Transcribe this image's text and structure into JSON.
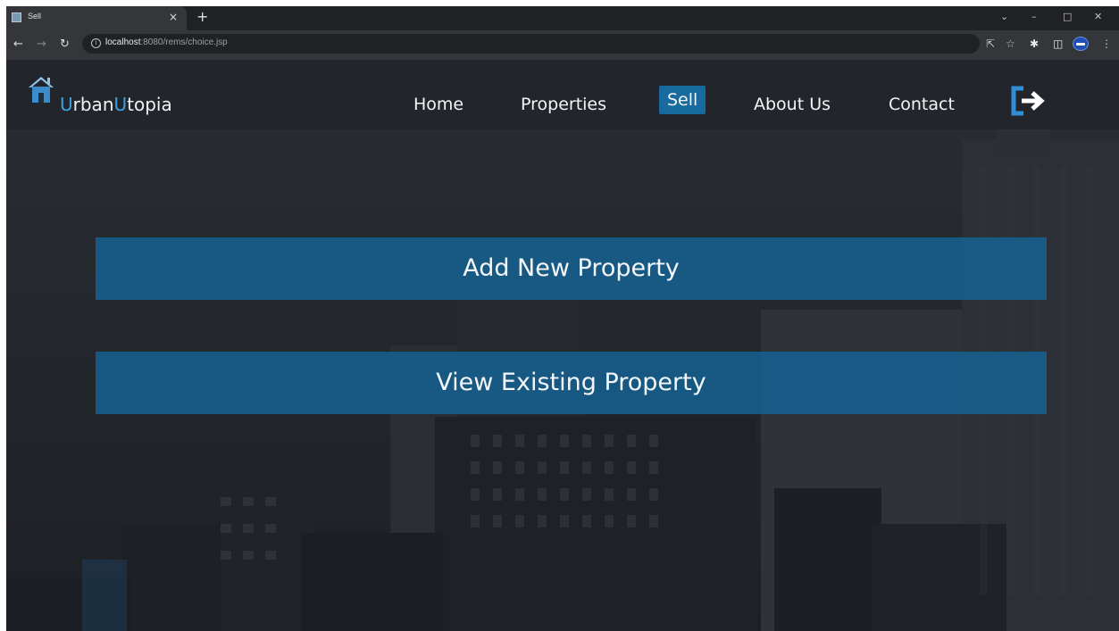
{
  "browser": {
    "tab_title": "Sell",
    "tab_close": "×",
    "new_tab": "+",
    "url_host": "localhost",
    "url_rest": ":8080/rems/choice.jsp",
    "icons": [
      "back-icon",
      "forward-icon",
      "reload-icon",
      "info-icon",
      "share-icon",
      "star-icon",
      "extensions-icon",
      "side-panel-icon",
      "profile-icon",
      "menu-icon"
    ]
  },
  "site": {
    "brand_first_initial": "U",
    "brand_first_rest": "rban",
    "brand_second_initial": "U",
    "brand_second_rest": "topia",
    "accent_color": "#3f9fe0",
    "nav": {
      "home": "Home",
      "properties": "Properties",
      "sell": "Sell",
      "about": "About Us",
      "contact": "Contact"
    },
    "active_nav": "Sell",
    "active_color": "#176b9e"
  },
  "actions": {
    "add_label": "Add New Property",
    "view_label": "View Existing Property",
    "button_color": "#16608f"
  }
}
